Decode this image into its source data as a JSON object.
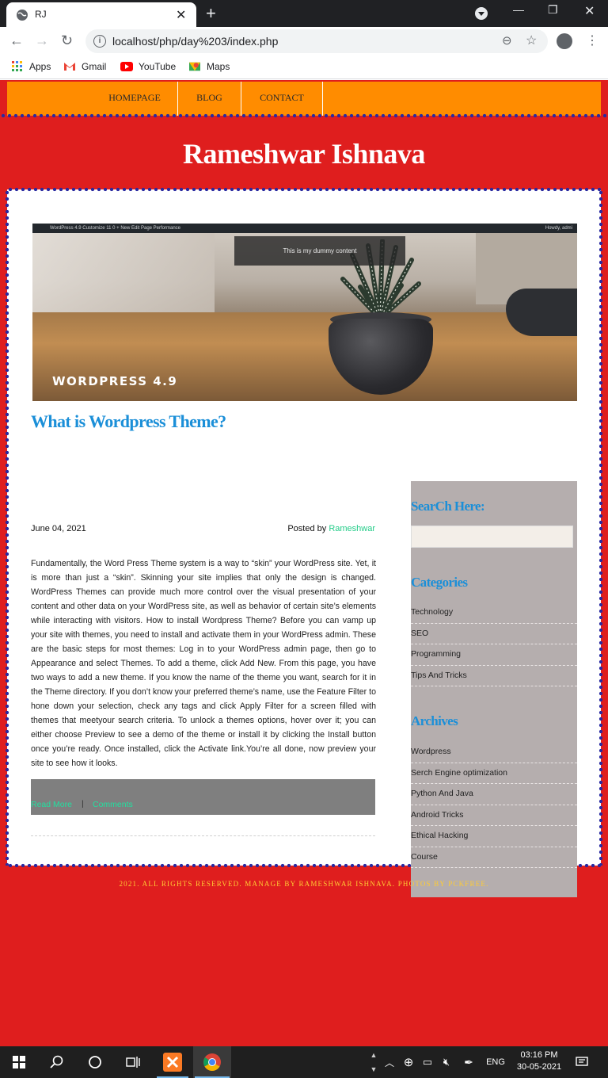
{
  "browser": {
    "tab_title": "RJ",
    "url": "localhost/php/day%203/index.php",
    "bookmarks": [
      "Apps",
      "Gmail",
      "YouTube",
      "Maps"
    ]
  },
  "nav": {
    "items": [
      "HOMEPAGE",
      "BLOG",
      "CONTACT"
    ]
  },
  "site": {
    "title": "Rameshwar Ishnava"
  },
  "hero": {
    "admin_bar": "WordPress 4.9    Customize    11    0    + New    Edit Page    Performance",
    "admin_bar_right": "Howdy, admi",
    "overlay_text": "This is my dummy content",
    "label": "WORDPRESS 4.9"
  },
  "post": {
    "title": "What is Wordpress Theme?",
    "date": "June 04, 2021",
    "posted_by": "Posted by ",
    "author": "Rameshwar",
    "body": "Fundamentally, the Word Press Theme system is a way to “skin” your WordPress site. Yet, it is more than just a “skin”. Skinning your site implies that only the design is changed. WordPress Themes can provide much more control over the visual presentation of your content and other data on your WordPress site, as well as behavior of certain site’s elements while interacting with visitors. How to install Wordpress Theme? Before you can vamp up your site with themes, you need to install and activate them in your WordPress admin. These are the basic steps for most themes: Log in to your WordPress admin page, then go to Appearance and select Themes. To add a theme, click Add New. From this page, you have two ways to add a new theme. If you know the name of the theme you want, search for it in the Theme directory. If you don’t know your preferred theme’s name, use the Feature Filter to hone down your selection, check any tags and click Apply Filter for a screen filled with themes that meetyour search criteria. To unlock a themes options, hover over it; you can either choose Preview to see a demo of the theme or install it by clicking the Install button once you’re ready. Once installed, click the Activate link.You’re all done, now preview your site to see how it looks.",
    "read_more": "Read More",
    "separator": "|",
    "comments": "Comments"
  },
  "sidebar": {
    "search_heading": "SearCh Here:",
    "search_value": "",
    "categories_heading": "Categories",
    "categories": [
      "Technology",
      "SEO",
      "Programming",
      "Tips And Tricks"
    ],
    "archives_heading": "Archives",
    "archives": [
      "Wordpress",
      "Serch Engine optimization",
      "Python And Java",
      "Android Tricks",
      "Ethical Hacking",
      "Course"
    ]
  },
  "footer": {
    "copyright": "2021. ALL RIGHTS RESERVED. MANAGE BY RAMESHWAR ISHNAVA. PHOTOS BY PCKFREE."
  },
  "taskbar": {
    "language": "ENG",
    "time": "03:16 PM",
    "date": "30-05-2021"
  },
  "colors": {
    "page_red": "#df1e1e",
    "nav_orange": "#ff8c00",
    "heading_blue": "#1b8fd8",
    "sidebar_gray": "#b5aeae",
    "link_green": "#22e0a0"
  }
}
